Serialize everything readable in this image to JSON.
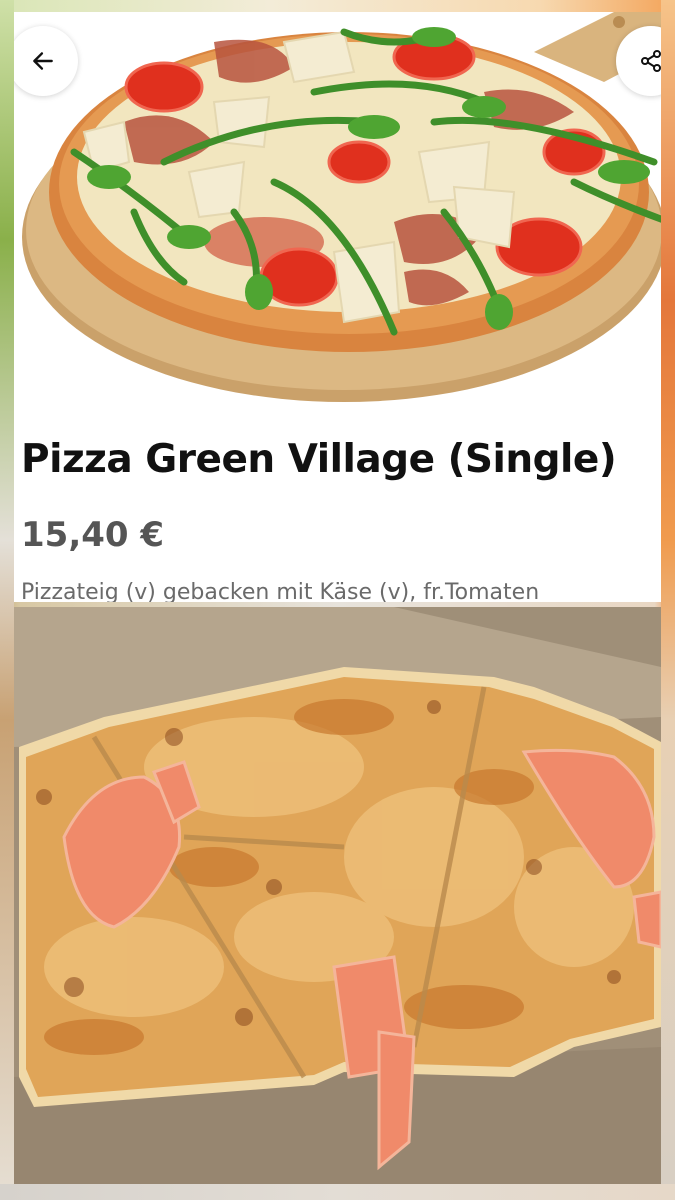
{
  "product": {
    "title": "Pizza Green Village (Single)",
    "price": "15,40 €",
    "description": "Pizzateig (v) gebacken mit Käse (v), fr.Tomaten"
  },
  "header": {
    "back_icon": "arrow-left-icon",
    "share_icon": "share-icon"
  },
  "colors": {
    "title": "#111111",
    "price": "#555555",
    "description": "#6a6a6a",
    "card_background": "#ffffff"
  }
}
